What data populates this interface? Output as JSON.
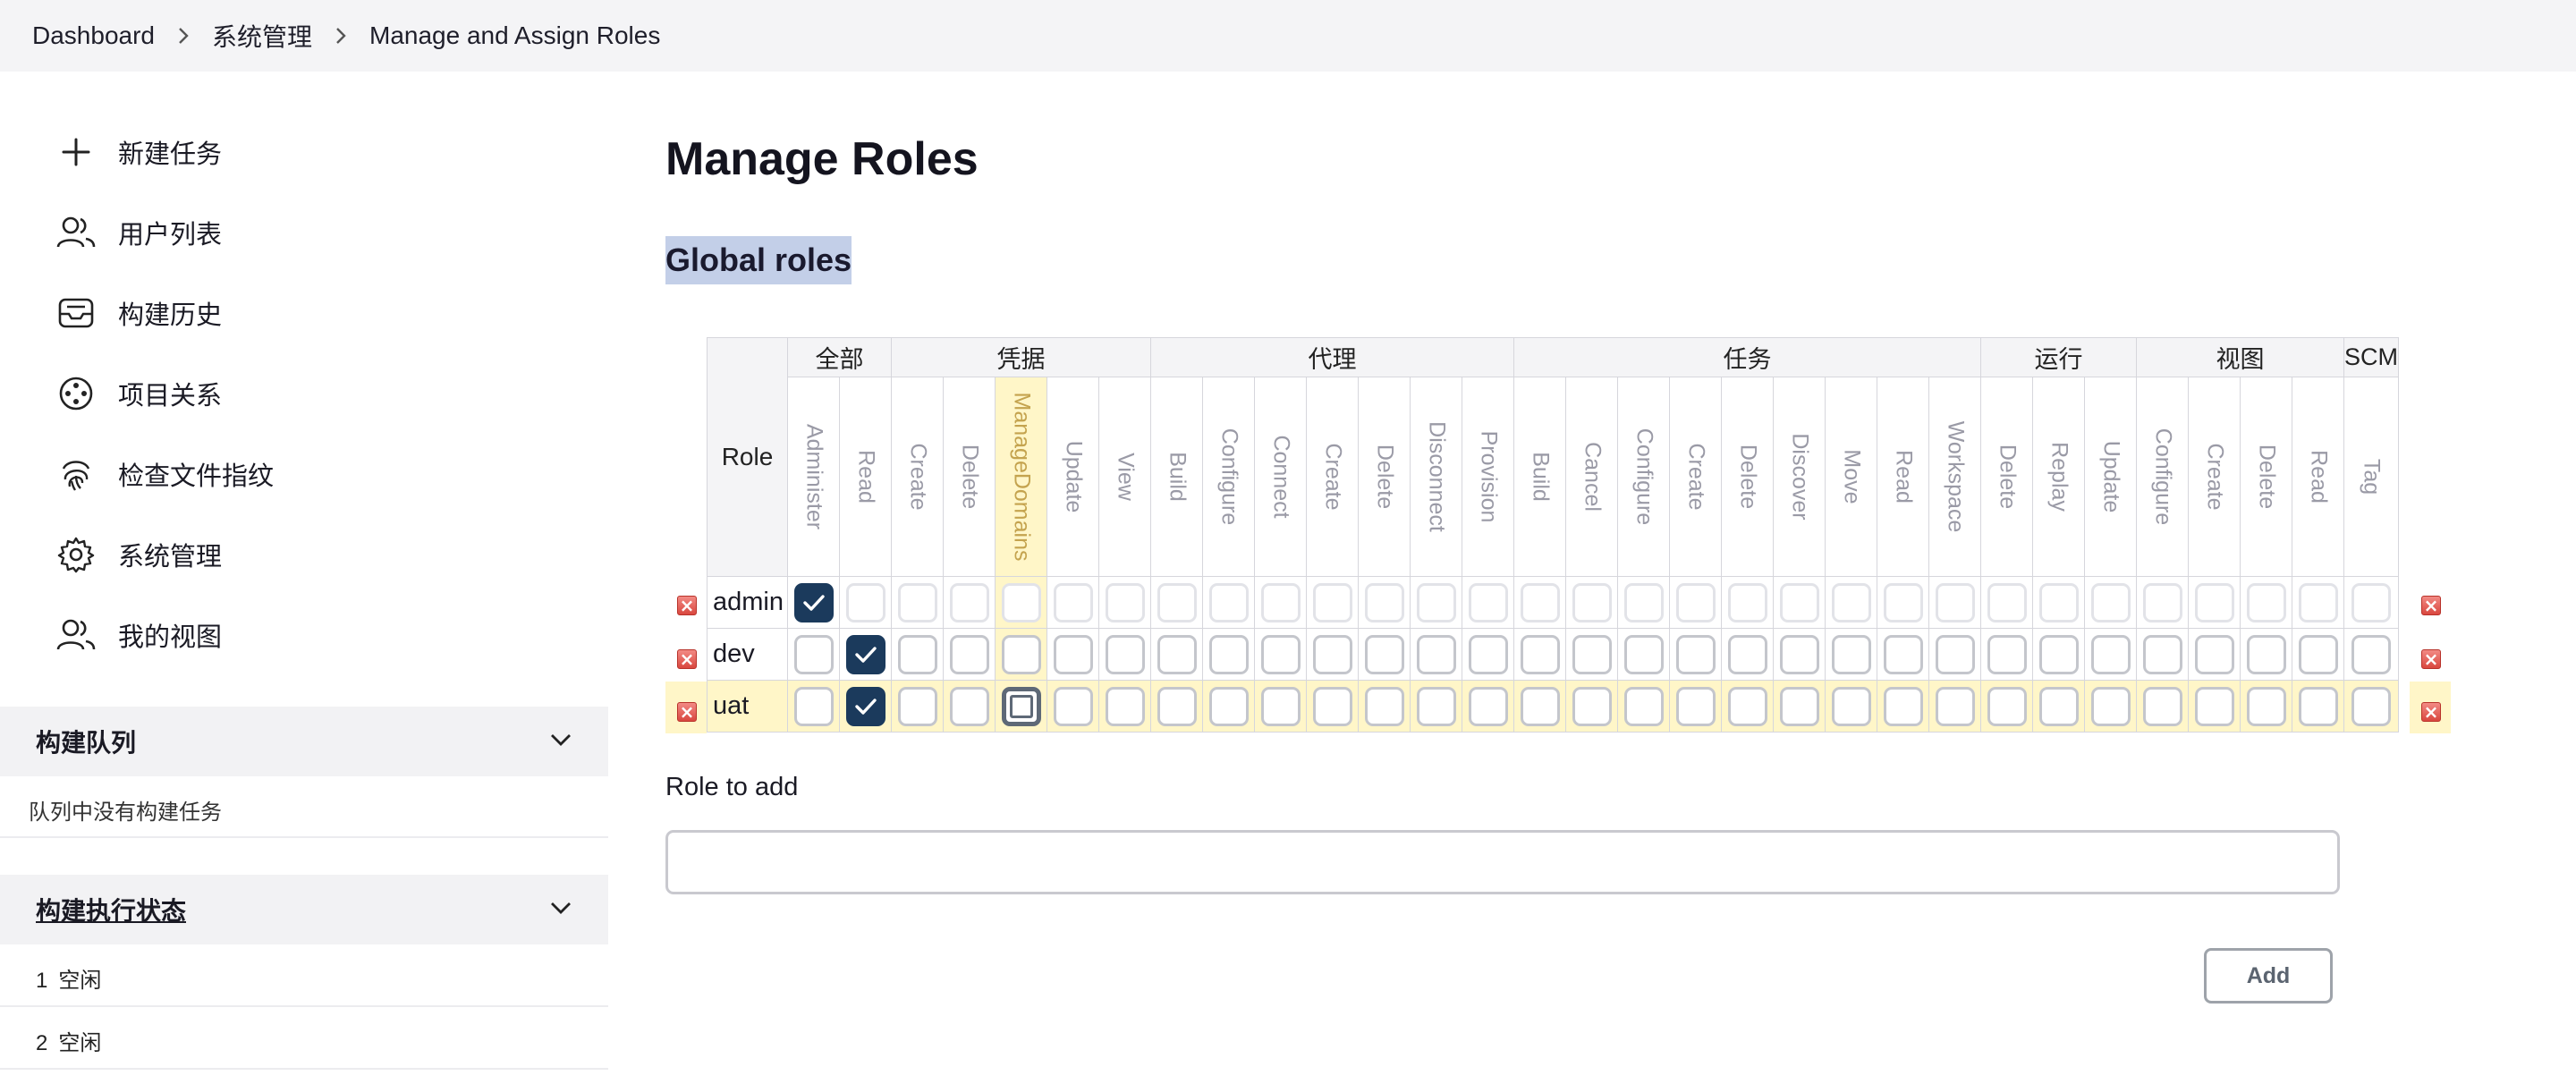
{
  "breadcrumb": [
    "Dashboard",
    "系统管理",
    "Manage and Assign Roles"
  ],
  "sidebar": {
    "items": [
      {
        "label": "新建任务",
        "icon": "plus-icon"
      },
      {
        "label": "用户列表",
        "icon": "users-icon"
      },
      {
        "label": "构建历史",
        "icon": "inbox-icon"
      },
      {
        "label": "项目关系",
        "icon": "relationship-icon"
      },
      {
        "label": "检查文件指纹",
        "icon": "fingerprint-icon"
      },
      {
        "label": "系统管理",
        "icon": "gear-icon"
      },
      {
        "label": "我的视图",
        "icon": "users-icon"
      }
    ],
    "build_queue": {
      "title": "构建队列",
      "empty_text": "队列中没有构建任务"
    },
    "executors": {
      "title": "构建执行状态",
      "rows": [
        {
          "num": "1",
          "status": "空闲"
        },
        {
          "num": "2",
          "status": "空闲"
        }
      ]
    }
  },
  "main": {
    "title": "Manage Roles",
    "section_title": "Global roles",
    "table": {
      "role_header": "Role",
      "groups": [
        {
          "name": "全部",
          "perms": [
            "Administer",
            "Read"
          ]
        },
        {
          "name": "凭据",
          "perms": [
            "Create",
            "Delete",
            "ManageDomains",
            "Update",
            "View"
          ]
        },
        {
          "name": "代理",
          "perms": [
            "Build",
            "Configure",
            "Connect",
            "Create",
            "Delete",
            "Disconnect",
            "Provision"
          ]
        },
        {
          "name": "任务",
          "perms": [
            "Build",
            "Cancel",
            "Configure",
            "Create",
            "Delete",
            "Discover",
            "Move",
            "Read",
            "Workspace"
          ]
        },
        {
          "name": "运行",
          "perms": [
            "Delete",
            "Replay",
            "Update"
          ]
        },
        {
          "name": "视图",
          "perms": [
            "Configure",
            "Create",
            "Delete",
            "Read"
          ]
        },
        {
          "name": "SCM",
          "perms": [
            "Tag"
          ]
        }
      ],
      "highlight_column": 4,
      "rows": [
        {
          "name": "admin",
          "checked": [
            0
          ]
        },
        {
          "name": "dev",
          "checked": [
            1
          ]
        },
        {
          "name": "uat",
          "checked": [
            1
          ],
          "selected": true,
          "focused": 4
        }
      ]
    },
    "role_to_add": {
      "label": "Role to add",
      "value": "",
      "placeholder": ""
    },
    "add_button": "Add"
  },
  "colors": {
    "accent": "#1b3a5c",
    "highlight": "#fff6c8",
    "section_highlight": "#c3cfe8",
    "delete": "#d9473f"
  }
}
